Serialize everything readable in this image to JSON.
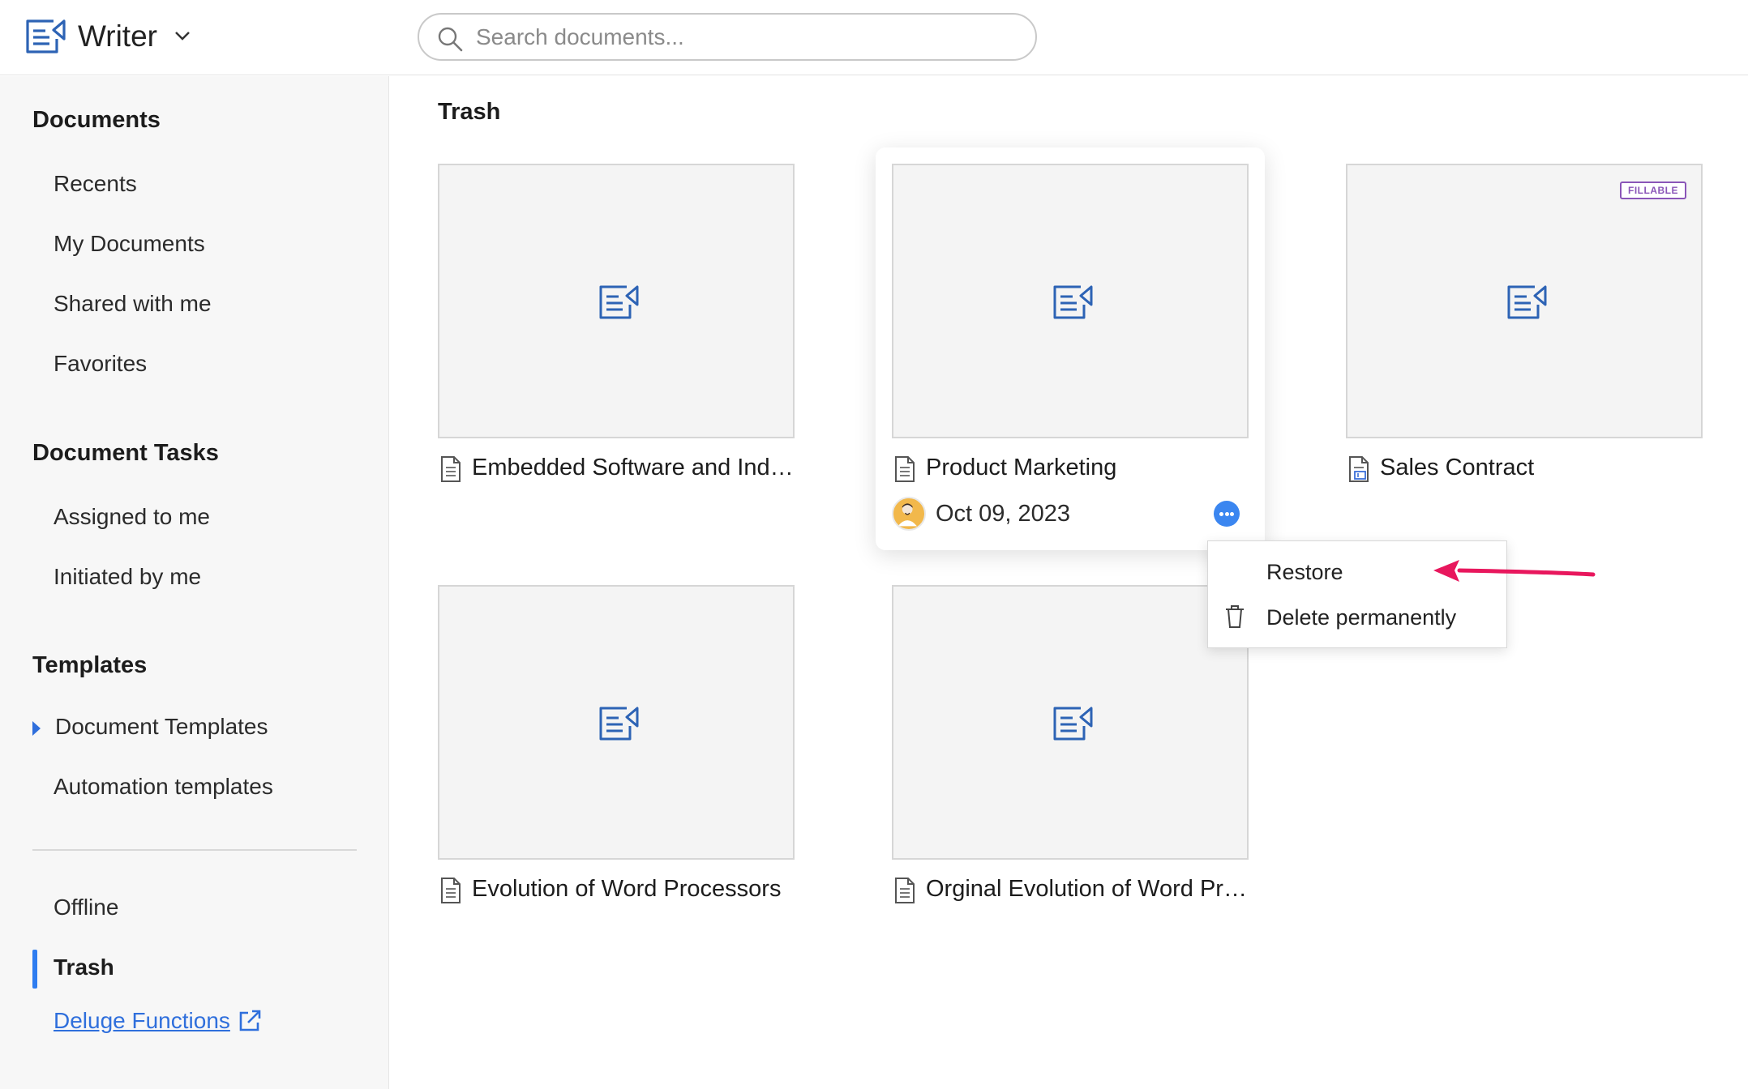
{
  "app": {
    "name": "Writer"
  },
  "search": {
    "placeholder": "Search documents..."
  },
  "sidebar": {
    "sections": [
      {
        "heading": "Documents",
        "items": [
          "Recents",
          "My Documents",
          "Shared with me",
          "Favorites"
        ]
      },
      {
        "heading": "Document Tasks",
        "items": [
          "Assigned to me",
          "Initiated by me"
        ]
      },
      {
        "heading": "Templates",
        "items": [
          "Document Templates",
          "Automation templates"
        ]
      }
    ],
    "bottom_items": [
      "Offline",
      "Trash"
    ],
    "active_item": "Trash",
    "link": "Deluge Functions"
  },
  "main": {
    "title": "Trash",
    "documents": [
      {
        "title": "Embedded Software and Indus...",
        "icon": "document-icon",
        "badge": ""
      },
      {
        "title": "Product Marketing",
        "icon": "document-icon",
        "badge": "",
        "date": "Oct 09, 2023",
        "hovered": true
      },
      {
        "title": "Sales Contract",
        "icon": "fillable-document-icon",
        "badge": "FILLABLE"
      },
      {
        "title": "Evolution of Word Processors",
        "icon": "document-icon",
        "badge": ""
      },
      {
        "title": "Orginal Evolution of Word Pro...",
        "icon": "document-icon",
        "badge": ""
      }
    ]
  },
  "context_menu": {
    "items": [
      {
        "label": "Restore",
        "icon": ""
      },
      {
        "label": "Delete permanently",
        "icon": "trash-icon"
      }
    ]
  },
  "colors": {
    "accent": "#2f6fdc",
    "active_bar": "#2f7df0",
    "annotation_arrow": "#e8175d",
    "fillable_badge": "#8a55b8"
  }
}
